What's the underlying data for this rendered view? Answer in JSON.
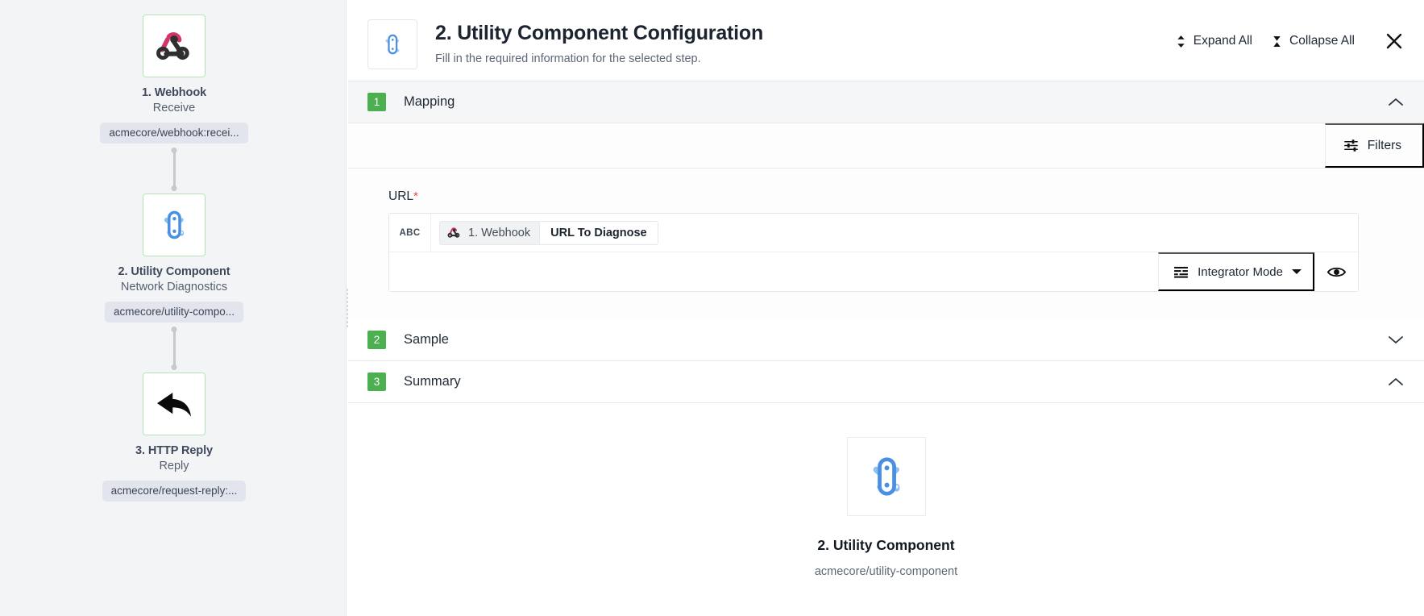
{
  "flow": {
    "steps": [
      {
        "icon": "webhook-icon",
        "title": "1. Webhook",
        "subtitle": "Receive",
        "tag": "acmecore/webhook:recei..."
      },
      {
        "icon": "utility-component-icon",
        "title": "2. Utility Component",
        "subtitle": "Network Diagnostics",
        "tag": "acmecore/utility-compo..."
      },
      {
        "icon": "reply-arrow-icon",
        "title": "3. HTTP Reply",
        "subtitle": "Reply",
        "tag": "acmecore/request-reply:..."
      }
    ]
  },
  "header": {
    "icon": "utility-component-icon",
    "title": "2. Utility Component Configuration",
    "subtitle": "Fill in the required information for the selected step.",
    "expand_all_label": "Expand All",
    "expand_all_icon": "expand-vertical-icon",
    "collapse_all_label": "Collapse All",
    "collapse_all_icon": "collapse-vertical-icon",
    "close_icon": "close-icon"
  },
  "sections": [
    {
      "number": "1",
      "title": "Mapping",
      "expanded": true,
      "chevron": "chevron-up-icon"
    },
    {
      "number": "2",
      "title": "Sample",
      "expanded": false,
      "chevron": "chevron-down-icon"
    },
    {
      "number": "3",
      "title": "Summary",
      "expanded": true,
      "chevron": "chevron-up-icon"
    }
  ],
  "mapping": {
    "filters_label": "Filters",
    "filters_icon": "filters-icon",
    "field": {
      "label": "URL",
      "required_marker": "*",
      "type_badge": "ABC",
      "token_source": "1. Webhook",
      "token_source_icon": "webhook-icon",
      "token_value": "URL To Diagnose"
    },
    "mode_label": "Integrator Mode",
    "mode_icon": "integrator-mode-icon",
    "mode_caret": "caret-down-icon",
    "preview_icon": "eye-icon"
  },
  "summary": {
    "icon": "utility-component-icon",
    "title": "2. Utility Component",
    "subtitle": "acmecore/utility-component"
  },
  "colors": {
    "badge_green": "#4caf50",
    "node_border_green": "#b5e3b7",
    "accent_blue": "#4a90e2",
    "webhook_pink": "#d6336c",
    "required_red": "#e74c3c",
    "panel_bg": "#f3f4f6"
  }
}
